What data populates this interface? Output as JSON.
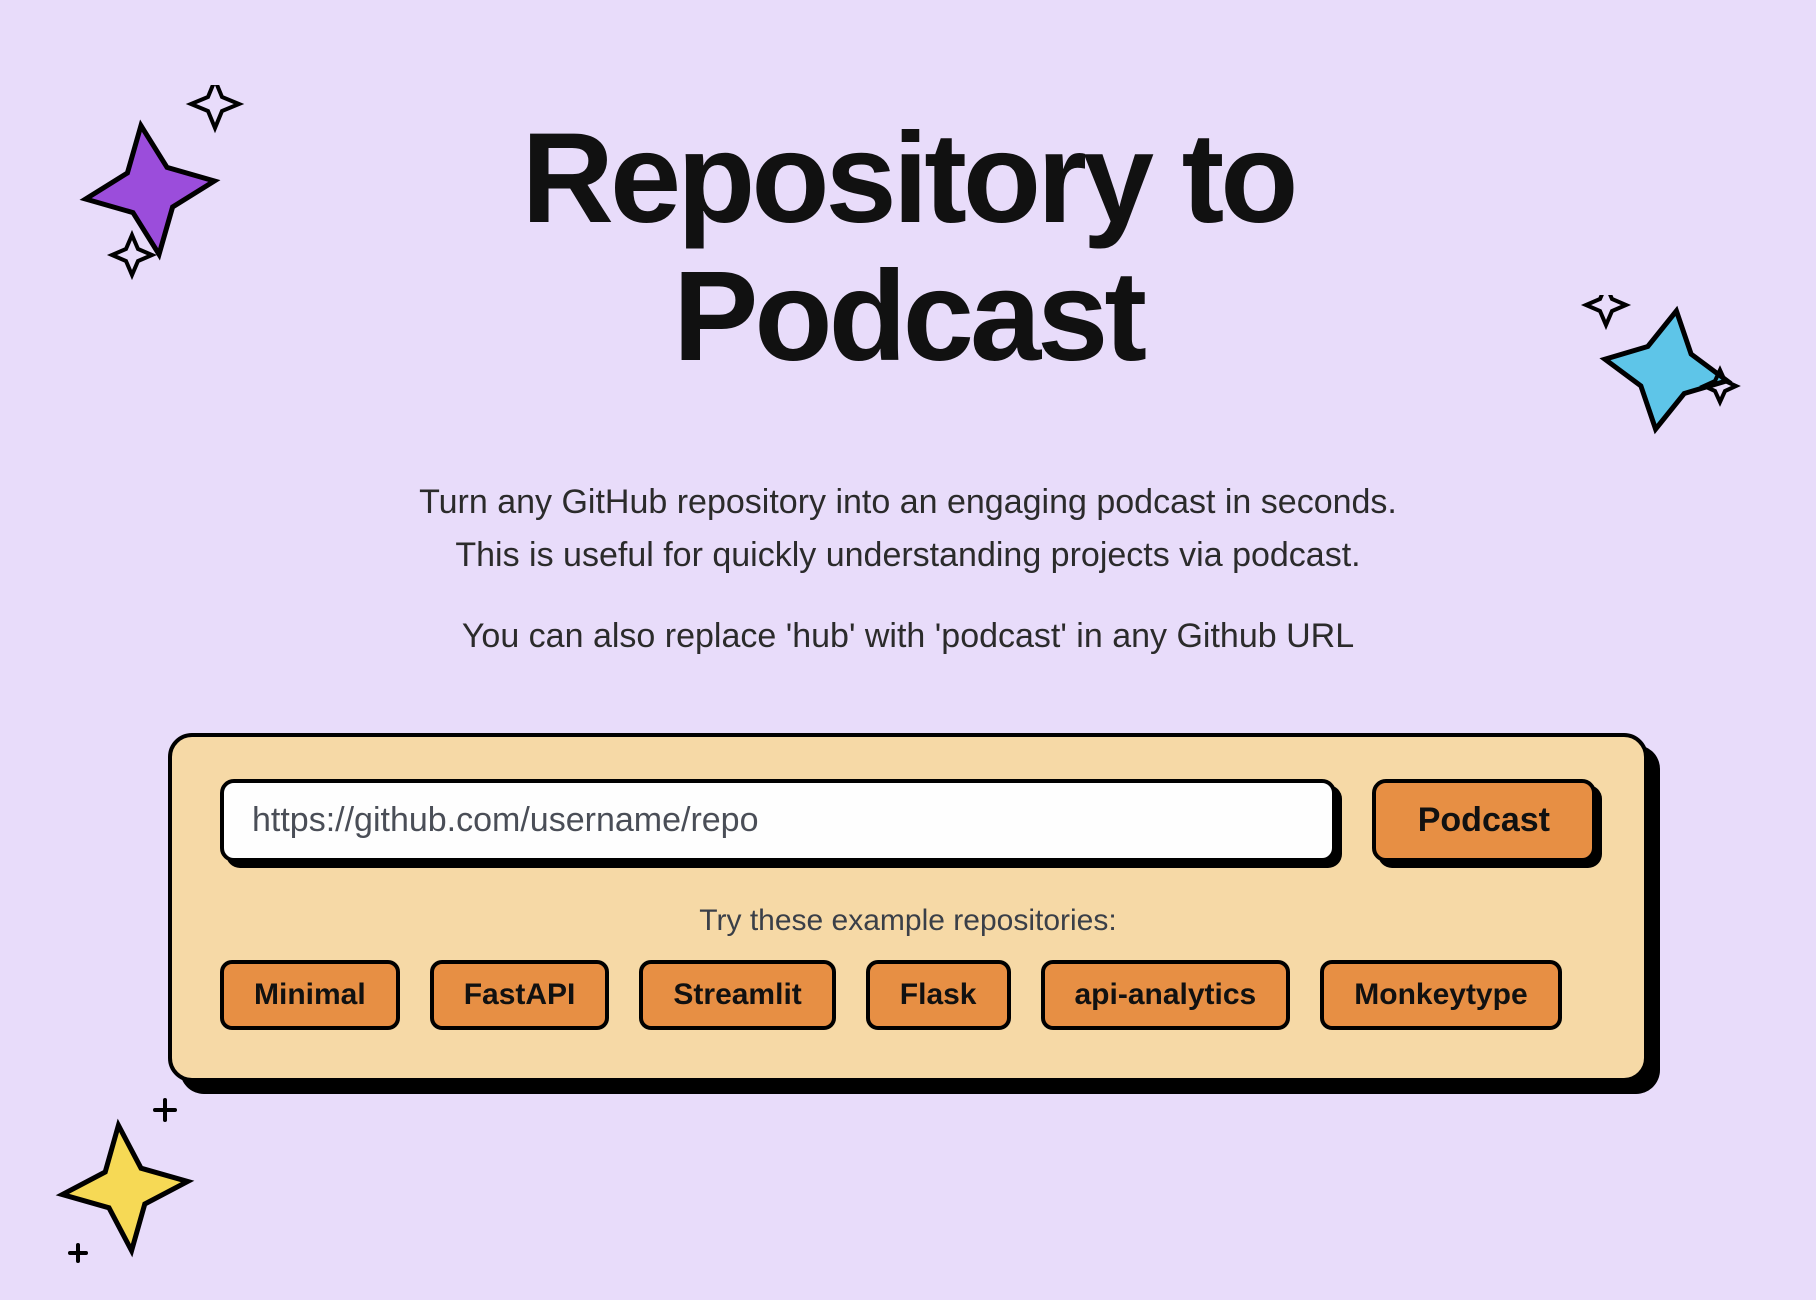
{
  "hero": {
    "title": "Repository to Podcast",
    "subtitle_line1": "Turn any GitHub repository into an engaging podcast in seconds.",
    "subtitle_line2": "This is useful for quickly understanding projects via podcast.",
    "subtitle_line3": "You can also replace 'hub' with 'podcast' in any Github URL"
  },
  "form": {
    "url_placeholder": "https://github.com/username/repo",
    "url_value": "",
    "submit_label": "Podcast"
  },
  "examples": {
    "label": "Try these example repositories:",
    "items": [
      "Minimal",
      "FastAPI",
      "Streamlit",
      "Flask",
      "api-analytics",
      "Monkeytype"
    ]
  },
  "colors": {
    "background": "#E8DCFA",
    "card": "#F6D9A6",
    "accent": "#E78F44",
    "sparkle_purple": "#9B4DDB",
    "sparkle_blue": "#5EC5E8",
    "sparkle_yellow": "#F6D955"
  }
}
